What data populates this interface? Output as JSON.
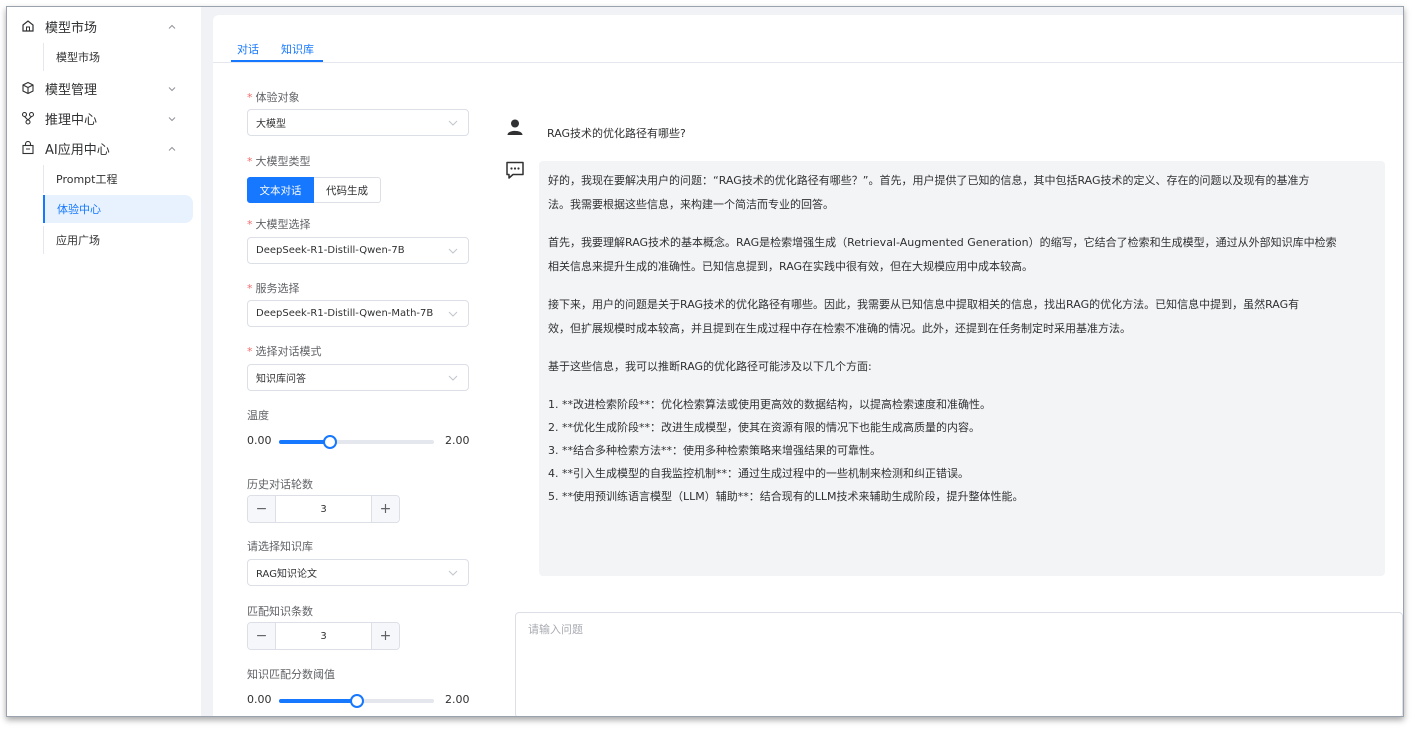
{
  "sidebar": {
    "groups": [
      {
        "label": "模型市场",
        "icon": "home-icon",
        "expanded": true
      },
      {
        "label": "模型管理",
        "icon": "cube-icon",
        "expanded": false
      },
      {
        "label": "推理中心",
        "icon": "hierarchy-icon",
        "expanded": false
      },
      {
        "label": "AI应用中心",
        "icon": "bag-icon",
        "expanded": true
      }
    ],
    "items": {
      "model_market": "模型市场",
      "prompt": "Prompt工程",
      "experience": "体验中心",
      "app_square": "应用广场"
    },
    "active_item": "体验中心"
  },
  "tabs": {
    "chat": "对话",
    "kb": "知识库"
  },
  "form": {
    "target_label": "体验对象",
    "target_value": "大模型",
    "type_label": "大模型类型",
    "type_options": [
      "文本对话",
      "代码生成"
    ],
    "type_selected": "文本对话",
    "model_label": "大模型选择",
    "model_value": "DeepSeek-R1-Distill-Qwen-7B",
    "service_label": "服务选择",
    "service_value": "DeepSeek-R1-Distill-Qwen-Math-7B",
    "mode_label": "选择对话模式",
    "mode_value": "知识库问答",
    "temp_label": "温度",
    "temp_min": "0.00",
    "temp_max": "2.00",
    "temp_fraction": 0.33,
    "history_label": "历史对话轮数",
    "history_value": "3",
    "kb_label": "请选择知识库",
    "kb_value": "RAG知识论文",
    "match_count_label": "匹配知识条数",
    "match_count_value": "3",
    "threshold_label": "知识匹配分数阈值",
    "threshold_min": "0.00",
    "threshold_max": "2.00",
    "threshold_fraction": 0.5,
    "stepper_minus": "−",
    "stepper_plus": "+"
  },
  "chat": {
    "question": "RAG技术的优化路径有哪些?",
    "answer": {
      "p1_l1": "好的，我现在要解决用户的问题：“RAG技术的优化路径有哪些？”。首先，用户提供了已知的信息，其中包括RAG技术的定义、存在的问题以及现有的基准方",
      "p1_l2": "法。我需要根据这些信息，来构建一个简洁而专业的回答。",
      "p2_l1": "首先，我要理解RAG技术的基本概念。RAG是检索增强生成（Retrieval-Augmented Generation）的缩写，它结合了检索和生成模型，通过从外部知识库中检索",
      "p2_l2": "相关信息来提升生成的准确性。已知信息提到，RAG在实践中很有效，但在大规模应用中成本较高。",
      "p3_l1": "接下来，用户的问题是关于RAG技术的优化路径有哪些。因此，我需要从已知信息中提取相关的信息，找出RAG的优化方法。已知信息中提到，虽然RAG有",
      "p3_l2": "效，但扩展规模时成本较高，并且提到在生成过程中存在检索不准确的情况。此外，还提到在任务制定时采用基准方法。",
      "p4": "基于这些信息，我可以推断RAG的优化路径可能涉及以下几个方面:",
      "list": [
        "1. **改进检索阶段**：优化检索算法或使用更高效的数据结构，以提高检索速度和准确性。",
        "2. **优化生成阶段**：改进生成模型，使其在资源有限的情况下也能生成高质量的内容。",
        "3. **结合多种检索方法**：使用多种检索策略来增强结果的可靠性。",
        "4. **引入生成模型的自我监控机制**：通过生成过程中的一些机制来检测和纠正错误。",
        "5. **使用预训练语言模型（LLM）辅助**：结合现有的LLM技术来辅助生成阶段，提升整体性能。"
      ]
    },
    "input_placeholder": "请输入问题"
  },
  "colors": {
    "accent": "#1677ff",
    "required": "#f56c6c",
    "answer_bg": "#f3f4f6"
  }
}
